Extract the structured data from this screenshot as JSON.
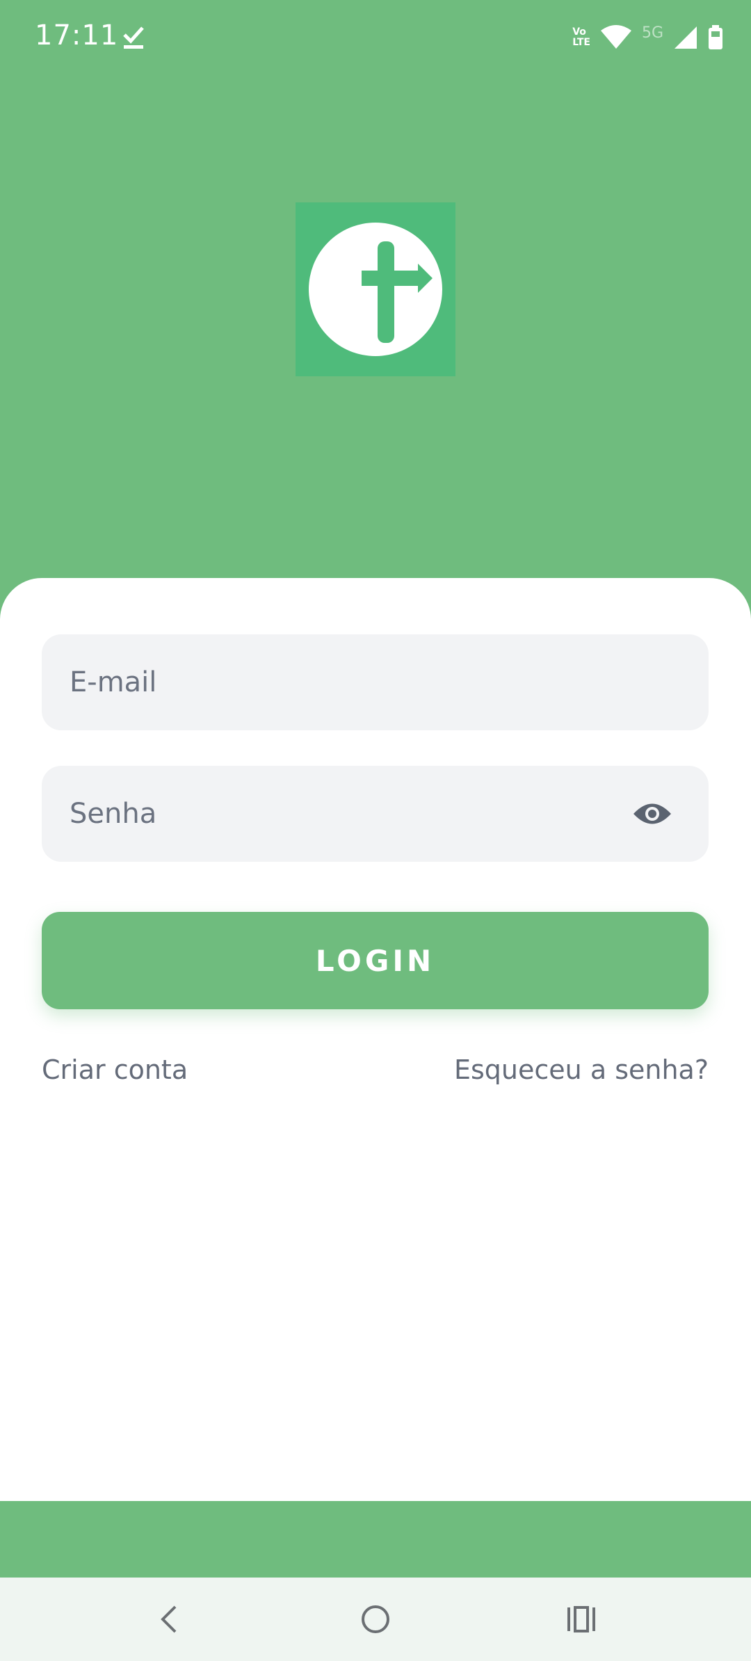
{
  "status_bar": {
    "time": "17:11",
    "volte_line1": "Vo",
    "volte_line2": "LTE",
    "network": "5G"
  },
  "logo": {
    "letter": "t"
  },
  "form": {
    "email_placeholder": "E-mail",
    "password_placeholder": "Senha",
    "login_label": "LOGIN",
    "create_account_label": "Criar conta",
    "forgot_password_label": "Esqueceu a senha?"
  },
  "colors": {
    "brand_green": "#6fbc7e",
    "logo_green": "#4fbb7b",
    "field_bg": "#f2f3f5",
    "link_text": "#646b79"
  },
  "icons": {
    "status_check": "check-icon",
    "wifi": "wifi-icon",
    "signal": "signal-icon",
    "battery": "battery-icon",
    "password_visibility": "eye-icon",
    "nav_back": "back-icon",
    "nav_home": "home-icon",
    "nav_recents": "recents-icon"
  }
}
